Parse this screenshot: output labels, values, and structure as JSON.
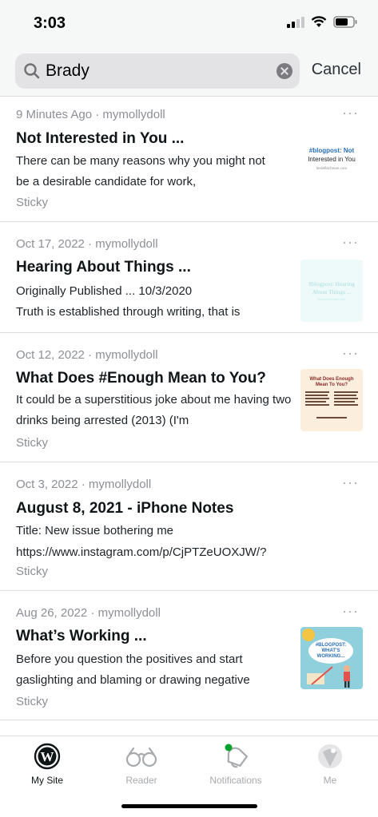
{
  "status_bar": {
    "time": "3:03"
  },
  "search": {
    "query": "Brady",
    "cancel_label": "Cancel"
  },
  "posts": [
    {
      "meta": "9 Minutes Ago · mymollydoll",
      "more": "···",
      "title": "Not Interested in You ...",
      "excerpt": "There can be many reasons why you might not be a desirable candidate for work,",
      "tag": "Sticky",
      "thumb_text": [
        "#blogpost: Not",
        "Interested in You",
        "leslieflachman.com"
      ]
    },
    {
      "meta": "Oct 17, 2022 · mymollydoll",
      "more": "···",
      "title": "Hearing About Things ...",
      "excerpt_line1": "Originally Published ... 10/3/2020",
      "excerpt_line2": "Truth is established through writing, that is",
      "thumb_text": [
        "#blogpost: Hearing",
        "About Things ...",
        "leslieflachman.com"
      ]
    },
    {
      "meta": "Oct 12, 2022 · mymollydoll",
      "more": "···",
      "title": "What Does #Enough Mean to You?",
      "excerpt": "It could be a superstitious joke about me having two drinks being arrested (2013) (I'm",
      "tag": "Sticky",
      "thumb_text": [
        "What Does Enough",
        "Mean To You?"
      ]
    },
    {
      "meta": "Oct 3, 2022 · mymollydoll",
      "more": "···",
      "title": "August 8, 2021 - iPhone Notes",
      "excerpt_line1": "Title: New issue bothering me",
      "excerpt_line2": "https://www.instagram.com/p/CjPTZeUOXJW/?",
      "tag": "Sticky"
    },
    {
      "meta": "Aug 26, 2022 · mymollydoll",
      "more": "···",
      "title": "What’s Working ...",
      "excerpt": "Before you question the positives and start gaslighting  and blaming or drawing negative",
      "tag": "Sticky",
      "thumb_text": [
        "#BLOGPOST:",
        "WHAT'S",
        "WORKING..."
      ]
    }
  ],
  "tabs": [
    {
      "label": "My Site",
      "icon": "wordpress-icon",
      "active": true
    },
    {
      "label": "Reader",
      "icon": "glasses-icon",
      "active": false
    },
    {
      "label": "Notifications",
      "icon": "bell-icon",
      "active": false
    },
    {
      "label": "Me",
      "icon": "avatar-icon",
      "active": false
    }
  ],
  "colors": {
    "accent_green": "#00a32a",
    "divider": "#dcdcde",
    "meta_gray": "#8c8f94"
  }
}
